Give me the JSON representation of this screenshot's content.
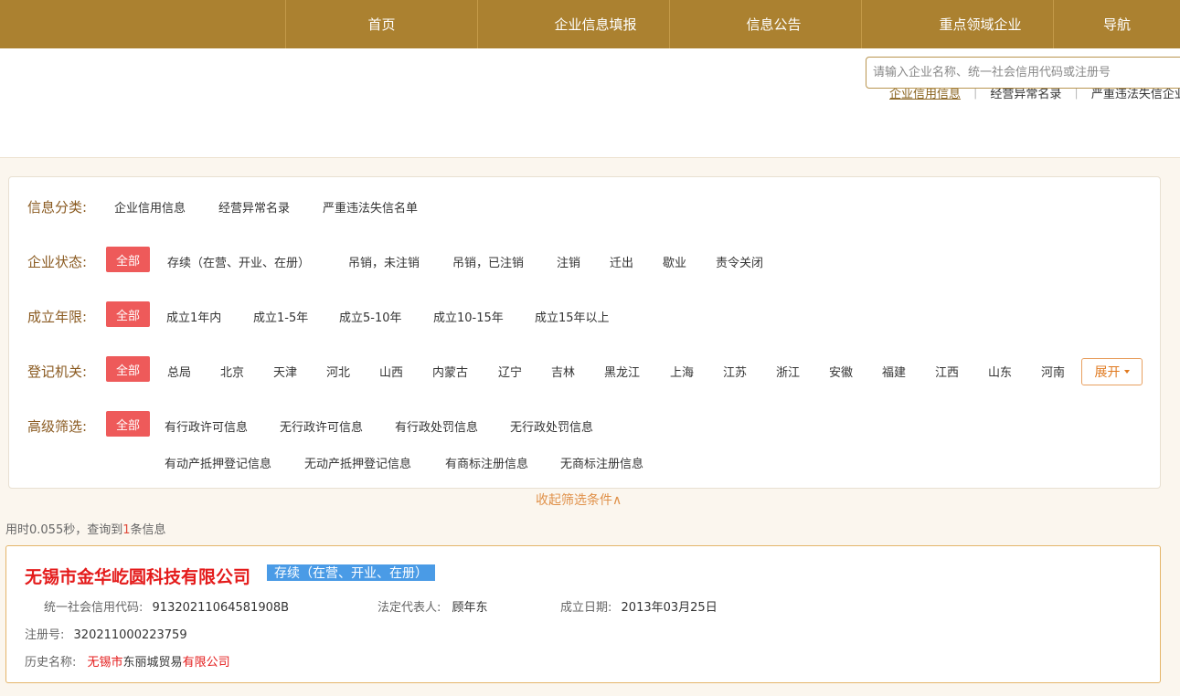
{
  "nav": {
    "items": [
      "首页",
      "企业信息填报",
      "信息公告",
      "重点领域企业",
      "导航"
    ]
  },
  "search": {
    "tabs": [
      "企业信用信息",
      "经营异常名录",
      "严重违法失信企业名单"
    ],
    "separator": "|",
    "placeholder": "请输入企业名称、统一社会信用代码或注册号"
  },
  "filters": {
    "category": {
      "label": "信息分类:",
      "items": [
        "企业信用信息",
        "经营异常名录",
        "严重违法失信名单"
      ]
    },
    "status": {
      "label": "企业状态:",
      "all": "全部",
      "items": [
        "存续（在营、开业、在册）",
        "吊销，未注销",
        "吊销，已注销",
        "注销",
        "迁出",
        "歇业",
        "责令关闭"
      ]
    },
    "years": {
      "label": "成立年限:",
      "all": "全部",
      "items": [
        "成立1年内",
        "成立1-5年",
        "成立5-10年",
        "成立10-15年",
        "成立15年以上"
      ]
    },
    "authority": {
      "label": "登记机关:",
      "all": "全部",
      "items": [
        "总局",
        "北京",
        "天津",
        "河北",
        "山西",
        "内蒙古",
        "辽宁",
        "吉林",
        "黑龙江",
        "上海",
        "江苏",
        "浙江",
        "安徽",
        "福建",
        "江西",
        "山东",
        "河南"
      ],
      "expand": "展开"
    },
    "advanced": {
      "label": "高级筛选:",
      "all": "全部",
      "items": [
        "有行政许可信息",
        "无行政许可信息",
        "有行政处罚信息",
        "无行政处罚信息",
        "有动产抵押登记信息",
        "无动产抵押登记信息",
        "有商标注册信息",
        "无商标注册信息"
      ]
    },
    "collapse": "收起筛选条件∧"
  },
  "stats": {
    "prefix": "用时0.055秒，查询到",
    "count": "1",
    "suffix": "条信息"
  },
  "result": {
    "name": "无锡市金华屹圆科技有限公司",
    "status": "存续（在营、开业、在册）",
    "credit_code_label": "统一社会信用代码:",
    "credit_code": "91320211064581908B",
    "legal_rep_label": "法定代表人:",
    "legal_rep": "顾年东",
    "founded_label": "成立日期:",
    "founded": "2013年03月25日",
    "reg_no_label": "注册号:",
    "reg_no": "320211000223759",
    "history_label": "历史名称:",
    "history_part1": "无锡市",
    "history_part2": "东丽城贸易",
    "history_part3": "有限公司"
  },
  "colors": {
    "nav": "#ab8130",
    "accent_red": "#ee5a5a",
    "badge_blue": "#4a9be6",
    "label_brown": "#8a5a20"
  }
}
